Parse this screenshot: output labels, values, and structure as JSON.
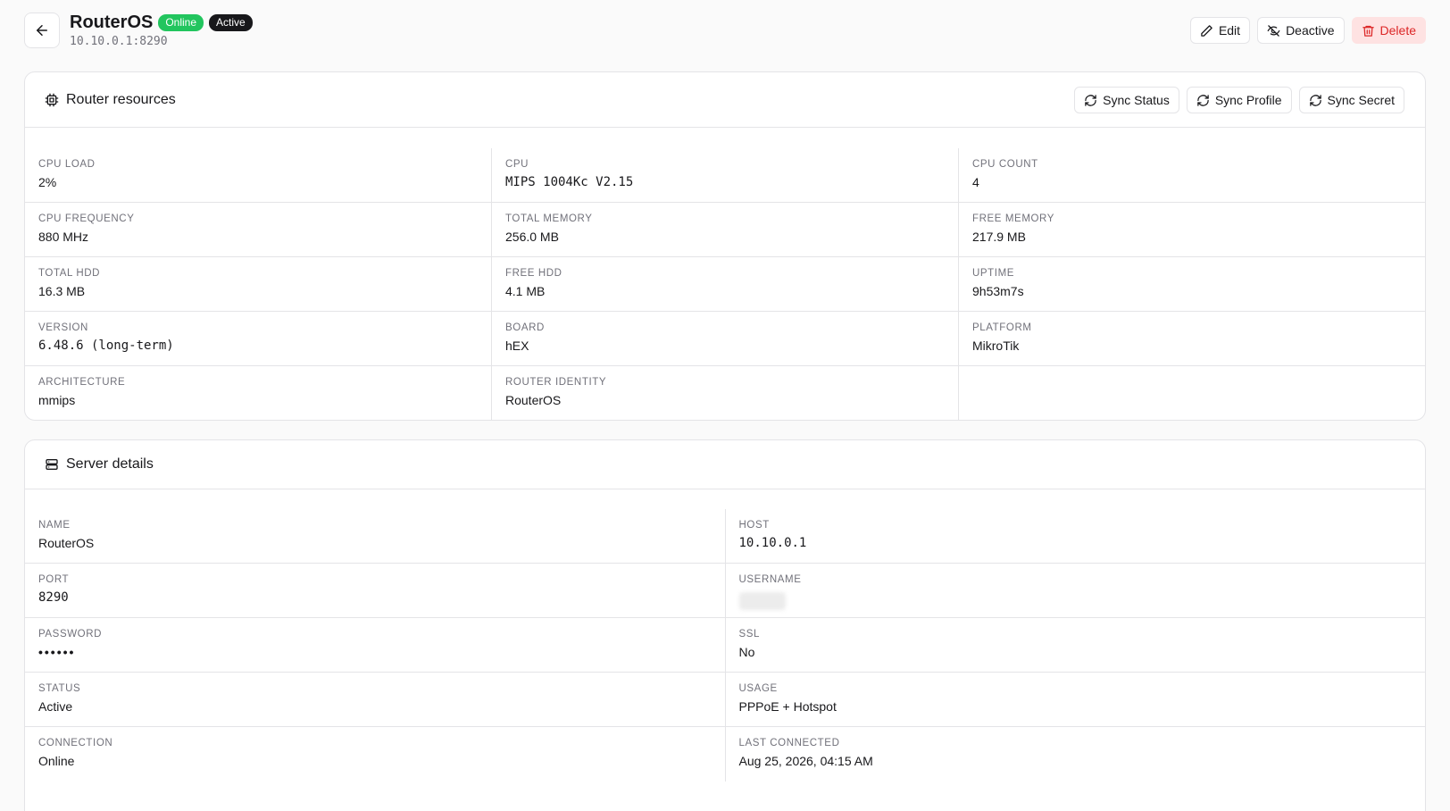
{
  "header": {
    "title": "RouterOS",
    "badge_online": "Online",
    "badge_active": "Active",
    "subtitle": "10.10.0.1:8290",
    "actions": {
      "edit": "Edit",
      "deactive": "Deactive",
      "delete": "Delete"
    }
  },
  "resources": {
    "title": "Router resources",
    "actions": {
      "sync_status": "Sync Status",
      "sync_profile": "Sync Profile",
      "sync_secret": "Sync Secret"
    },
    "rows": [
      [
        {
          "label": "CPU LOAD",
          "value": "2%"
        },
        {
          "label": "CPU",
          "value": "MIPS 1004Kc V2.15"
        },
        {
          "label": "CPU COUNT",
          "value": "4"
        }
      ],
      [
        {
          "label": "CPU FREQUENCY",
          "value": "880 MHz"
        },
        {
          "label": "TOTAL MEMORY",
          "value": "256.0 MB"
        },
        {
          "label": "FREE MEMORY",
          "value": "217.9 MB"
        }
      ],
      [
        {
          "label": "TOTAL HDD",
          "value": "16.3 MB"
        },
        {
          "label": "FREE HDD",
          "value": "4.1 MB"
        },
        {
          "label": "UPTIME",
          "value": "9h53m7s"
        }
      ],
      [
        {
          "label": "VERSION",
          "value": "6.48.6 (long-term)"
        },
        {
          "label": "BOARD",
          "value": "hEX"
        },
        {
          "label": "PLATFORM",
          "value": "MikroTik"
        }
      ],
      [
        {
          "label": "ARCHITECTURE",
          "value": "mmips"
        },
        {
          "label": "ROUTER IDENTITY",
          "value": "RouterOS"
        },
        {
          "label": "",
          "value": ""
        }
      ]
    ]
  },
  "server": {
    "title": "Server details",
    "rows": [
      [
        {
          "label": "NAME",
          "value": "RouterOS"
        },
        {
          "label": "HOST",
          "value": "10.10.0.1"
        }
      ],
      [
        {
          "label": "PORT",
          "value": "8290"
        },
        {
          "label": "USERNAME",
          "value": ""
        }
      ],
      [
        {
          "label": "PASSWORD",
          "value": "••••••"
        },
        {
          "label": "SSL",
          "value": "No"
        }
      ],
      [
        {
          "label": "STATUS",
          "value": "Active"
        },
        {
          "label": "USAGE",
          "value": "PPPoE + Hotspot"
        }
      ],
      [
        {
          "label": "CONNECTION",
          "value": "Online"
        },
        {
          "label": "LAST CONNECTED",
          "value": "Aug 25, 2026, 04:15 AM"
        }
      ]
    ]
  },
  "colors": {
    "online": "#22c55e",
    "active": "#18181b",
    "danger": "#dc2626",
    "danger_bg": "#fee2e2"
  },
  "icons": {
    "back": "arrow-left-icon",
    "edit": "pencil-icon",
    "deactive": "eye-off-icon",
    "delete": "trash-icon",
    "resources": "cpu-icon",
    "sync": "refresh-icon",
    "server": "server-icon"
  }
}
